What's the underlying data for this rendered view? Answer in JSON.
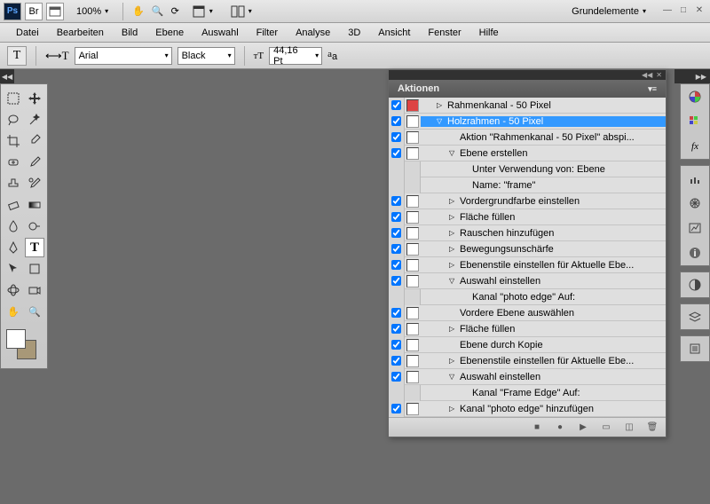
{
  "titlebar": {
    "zoom": "100%",
    "workspace": "Grundelemente"
  },
  "menu": [
    "Datei",
    "Bearbeiten",
    "Bild",
    "Ebene",
    "Auswahl",
    "Filter",
    "Analyse",
    "3D",
    "Ansicht",
    "Fenster",
    "Hilfe"
  ],
  "optbar": {
    "font": "Arial",
    "style": "Black",
    "size": "44,16 Pt"
  },
  "actions": {
    "title": "Aktionen",
    "rows": [
      {
        "chk": true,
        "dlg": "red",
        "depth": 1,
        "disc": "right",
        "text": "Rahmenkanal - 50 Pixel"
      },
      {
        "chk": true,
        "dlg": "box",
        "depth": 1,
        "disc": "down",
        "text": "Holzrahmen - 50 Pixel",
        "sel": true
      },
      {
        "chk": true,
        "dlg": "box",
        "depth": 2,
        "disc": "",
        "text": "Aktion \"Rahmenkanal - 50 Pixel\" abspi..."
      },
      {
        "chk": true,
        "dlg": "box",
        "depth": 2,
        "disc": "down",
        "text": "Ebene erstellen"
      },
      {
        "chk": null,
        "dlg": "",
        "depth": 3,
        "disc": "",
        "text": "Unter Verwendung von: Ebene"
      },
      {
        "chk": null,
        "dlg": "",
        "depth": 3,
        "disc": "",
        "text": "Name:  \"frame\""
      },
      {
        "chk": true,
        "dlg": "box",
        "depth": 2,
        "disc": "right",
        "text": "Vordergrundfarbe einstellen"
      },
      {
        "chk": true,
        "dlg": "box",
        "depth": 2,
        "disc": "right",
        "text": "Fläche füllen"
      },
      {
        "chk": true,
        "dlg": "box",
        "depth": 2,
        "disc": "right",
        "text": "Rauschen hinzufügen"
      },
      {
        "chk": true,
        "dlg": "box",
        "depth": 2,
        "disc": "right",
        "text": "Bewegungsunschärfe"
      },
      {
        "chk": true,
        "dlg": "box",
        "depth": 2,
        "disc": "right",
        "text": "Ebenenstile einstellen  für Aktuelle Ebe..."
      },
      {
        "chk": true,
        "dlg": "box",
        "depth": 2,
        "disc": "down",
        "text": "Auswahl einstellen"
      },
      {
        "chk": null,
        "dlg": "",
        "depth": 3,
        "disc": "",
        "text": "Kanal \"photo edge\" Auf:"
      },
      {
        "chk": true,
        "dlg": "box",
        "depth": 2,
        "disc": "",
        "text": "Vordere Ebene auswählen"
      },
      {
        "chk": true,
        "dlg": "box",
        "depth": 2,
        "disc": "right",
        "text": "Fläche füllen"
      },
      {
        "chk": true,
        "dlg": "box",
        "depth": 2,
        "disc": "",
        "text": "Ebene durch Kopie"
      },
      {
        "chk": true,
        "dlg": "box",
        "depth": 2,
        "disc": "right",
        "text": "Ebenenstile einstellen  für Aktuelle Ebe..."
      },
      {
        "chk": true,
        "dlg": "box",
        "depth": 2,
        "disc": "down",
        "text": "Auswahl einstellen"
      },
      {
        "chk": null,
        "dlg": "",
        "depth": 3,
        "disc": "",
        "text": "Kanal \"Frame Edge\" Auf:"
      },
      {
        "chk": true,
        "dlg": "box",
        "depth": 2,
        "disc": "right",
        "text": "Kanal \"photo edge\" hinzufügen"
      }
    ]
  }
}
